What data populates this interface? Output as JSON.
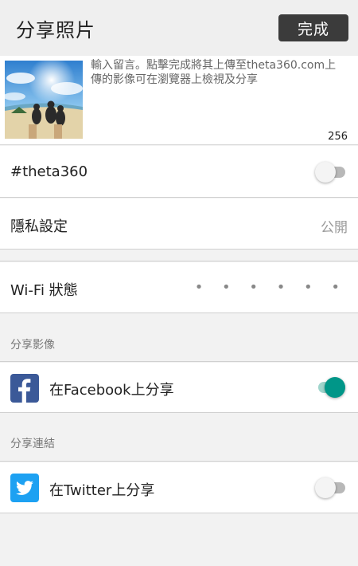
{
  "header": {
    "title": "分享照片",
    "done_label": "完成"
  },
  "comment": {
    "placeholder": "輸入留言。點擊完成將其上傳至theta360.com上傳的影像可在瀏覽器上檢視及分享",
    "char_count": "256"
  },
  "hashtag": {
    "label": "#theta360",
    "enabled": false
  },
  "privacy": {
    "label": "隱私設定",
    "value": "公開"
  },
  "wifi": {
    "label": "Wi-Fi 狀態",
    "value": "• • • • • •"
  },
  "share_image": {
    "section_title": "分享影像",
    "facebook_label": "在Facebook上分享",
    "facebook_enabled": true
  },
  "share_link": {
    "section_title": "分享連結",
    "twitter_label": "在Twitter上分享",
    "twitter_enabled": false
  },
  "colors": {
    "accent": "#009688",
    "facebook": "#3b5998",
    "twitter": "#1da1f2",
    "done_button": "#3b3b3b"
  }
}
